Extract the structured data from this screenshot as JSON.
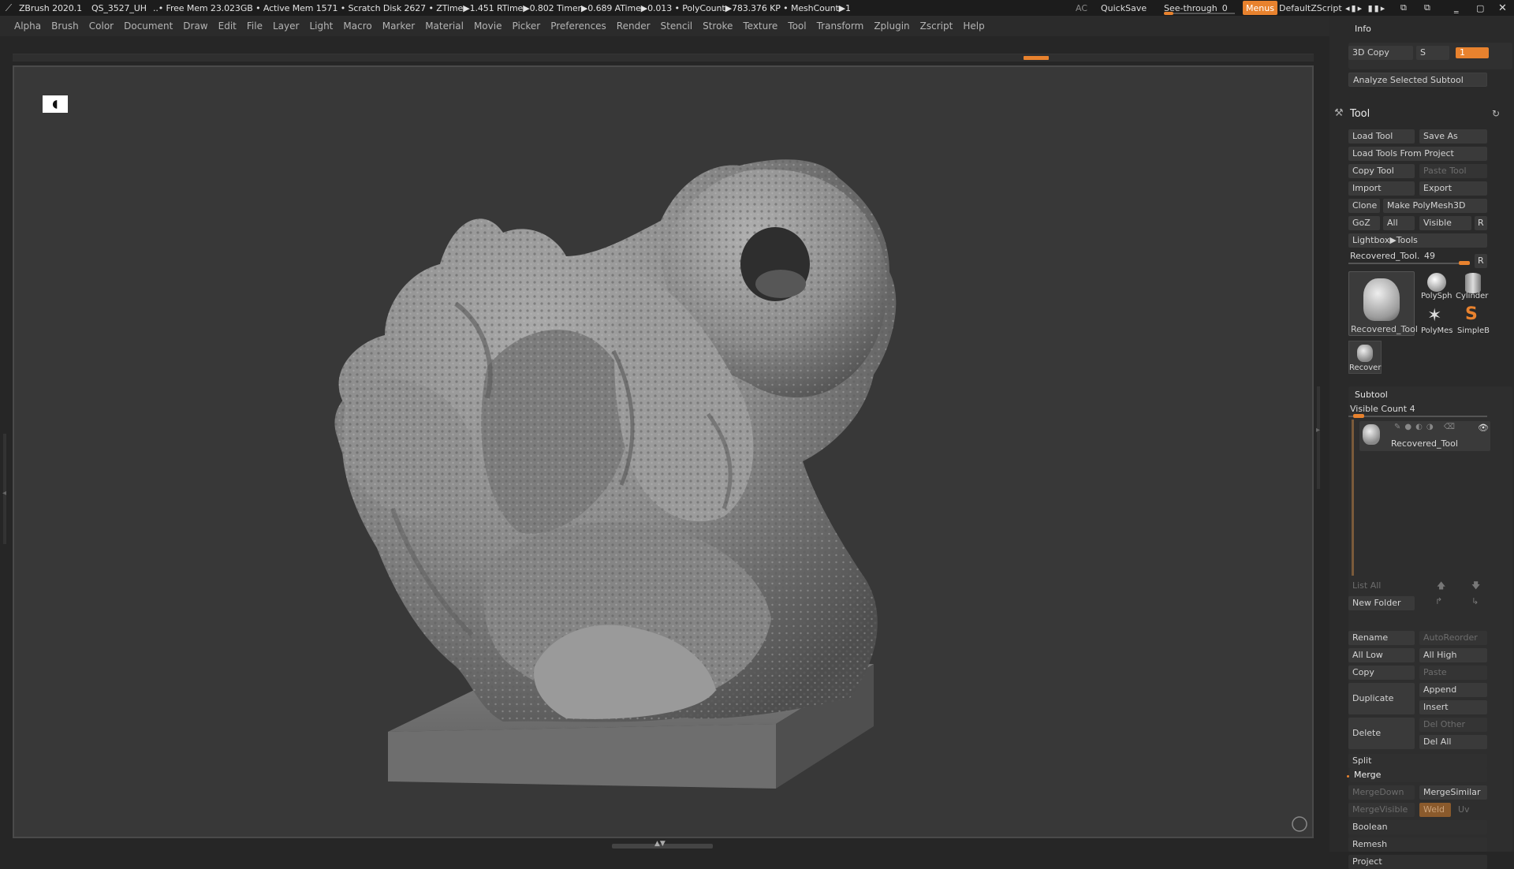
{
  "window": {
    "app": "ZBrush 2020.1",
    "doc": "QS_3527_UH",
    "status": "..• Free Mem 23.023GB • Active Mem 1571 • Scratch Disk 2627 • ZTime▶1.451 RTime▶0.802 Timer▶0.689 ATime▶0.013 • PolyCount▶783.376 KP • MeshCount▶1"
  },
  "topright": {
    "ac": "AC",
    "quicksave": "QuickSave",
    "seethrough": "See-through",
    "seethrough_value": "0",
    "seethrough_level": 0.0,
    "menus": "Menus",
    "script": "DefaultZScript",
    "accent": "#e8822e"
  },
  "menu": [
    "Alpha",
    "Brush",
    "Color",
    "Document",
    "Draw",
    "Edit",
    "File",
    "Layer",
    "Light",
    "Macro",
    "Marker",
    "Material",
    "Movie",
    "Picker",
    "Preferences",
    "Render",
    "Stencil",
    "Stroke",
    "Texture",
    "Tool",
    "Transform",
    "Zplugin",
    "Zscript",
    "Help"
  ],
  "panel": {
    "info": "Info",
    "copy3d": "3D Copy",
    "copy3d_s": "S",
    "copy3d_value": "1",
    "analyze": "Analyze Selected Subtool",
    "tool_title": "Tool",
    "load_tool": "Load Tool",
    "save_as": "Save As",
    "load_from_project": "Load Tools From Project",
    "copy_tool": "Copy Tool",
    "paste_tool": "Paste Tool",
    "import": "Import",
    "export": "Export",
    "clone": "Clone",
    "make_polymesh": "Make PolyMesh3D",
    "goz": "GoZ",
    "all": "All",
    "visible": "Visible",
    "r": "R",
    "lightbox": "Lightbox▶Tools",
    "current_tool": "Recovered_Tool.",
    "current_tool_num": "49",
    "thumbs": [
      "Recovered_Tool",
      "PolySph",
      "Cylinder",
      "PolyMes",
      "SimpleB",
      "Recover"
    ],
    "subtool": "Subtool",
    "visible_count": "Visible Count 4",
    "subtool_item": "Recovered_Tool",
    "list_all": "List All",
    "new_folder": "New Folder",
    "rename": "Rename",
    "auto_reorder": "AutoReorder",
    "all_low": "All Low",
    "all_high": "All High",
    "copy": "Copy",
    "paste": "Paste",
    "duplicate": "Duplicate",
    "append": "Append",
    "insert": "Insert",
    "delete": "Delete",
    "del_other": "Del Other",
    "del_all": "Del All",
    "split": "Split",
    "merge": "Merge",
    "merge_down": "MergeDown",
    "merge_similar": "MergeSimilar",
    "merge_visible": "MergeVisible",
    "weld": "Weld",
    "uv": "Uv",
    "boolean": "Boolean",
    "remesh": "Remesh",
    "project": "Project"
  }
}
